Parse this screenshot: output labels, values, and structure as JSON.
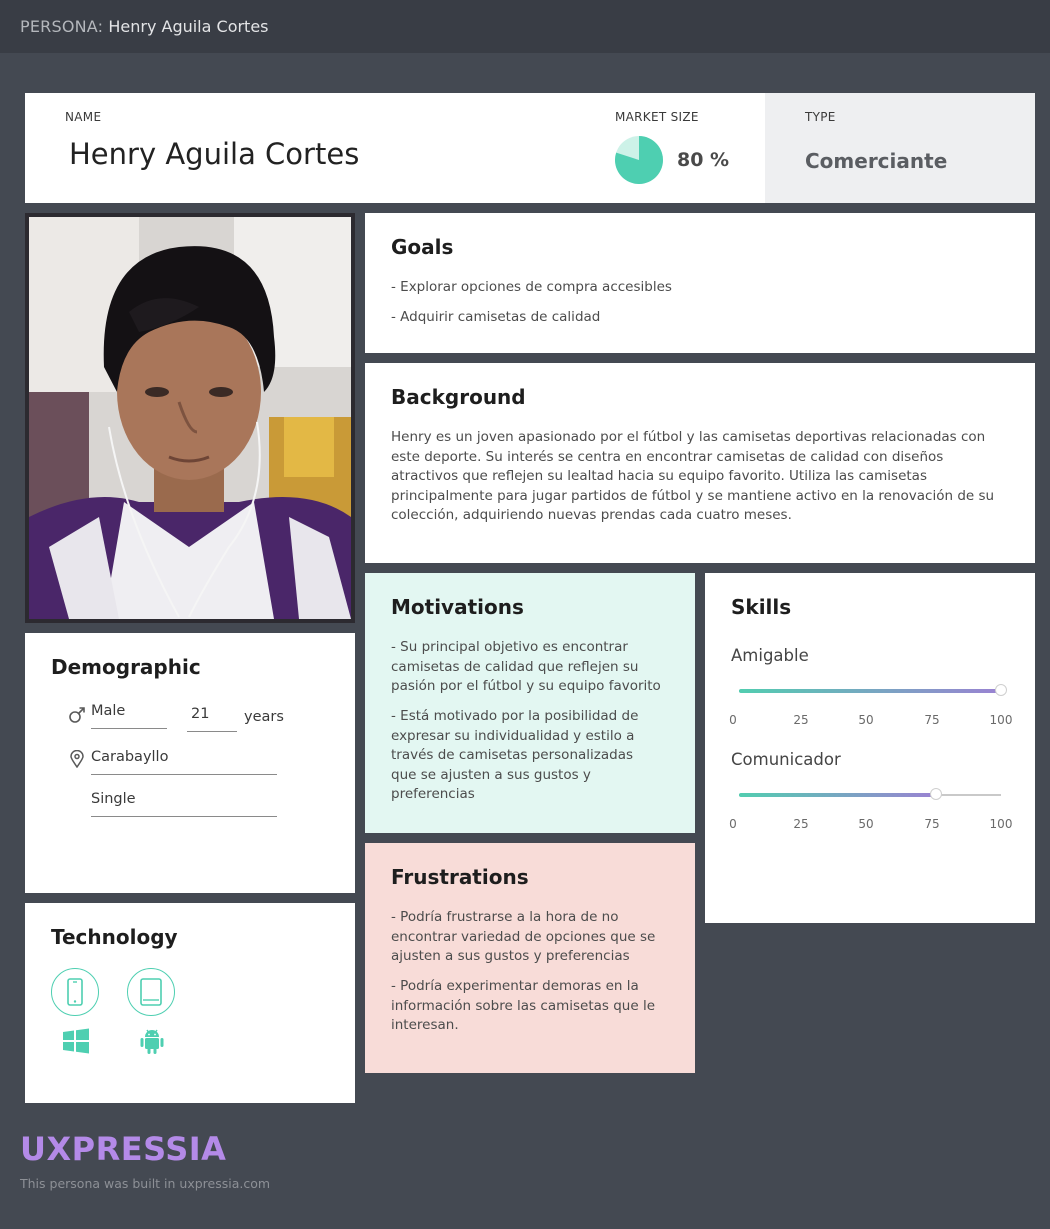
{
  "topbar": {
    "label": "PERSONA:",
    "name": "Henry Aguila Cortes"
  },
  "header": {
    "name_label": "NAME",
    "name": "Henry Aguila Cortes",
    "market_label": "MARKET SIZE",
    "market_value": "80 %",
    "market_fraction": 0.8,
    "type_label": "TYPE",
    "type_value": "Comerciante"
  },
  "colors": {
    "accent": "#4ecfb1",
    "accent_light": "#cdf2e8",
    "brand": "#b48ae8"
  },
  "goals": {
    "title": "Goals",
    "items": [
      "- Explorar opciones de compra accesibles",
      "- Adquirir camisetas de calidad"
    ]
  },
  "background": {
    "title": "Background",
    "text": "Henry es un joven apasionado por el fútbol y las camisetas deportivas relacionadas con este deporte. Su interés se centra en encontrar camisetas de calidad con diseños atractivos que reflejen su lealtad hacia su equipo favorito. Utiliza las camisetas principalmente para jugar partidos de fútbol y se mantiene activo en la renovación de su colección, adquiriendo nuevas prendas cada cuatro meses."
  },
  "motivations": {
    "title": "Motivations",
    "items": [
      "- Su principal objetivo es encontrar camisetas de calidad que reflejen su pasión por el fútbol y su equipo favorito",
      "- Está motivado por la posibilidad de expresar su individualidad y estilo a través de camisetas personalizadas que se ajusten a sus gustos y preferencias"
    ]
  },
  "frustrations": {
    "title": "Frustrations",
    "items": [
      "- Podría frustrarse a la hora de no encontrar variedad de opciones que se ajusten a sus gustos y preferencias",
      "- Podría experimentar demoras en la información sobre las camisetas que le interesan."
    ]
  },
  "skills": {
    "title": "Skills",
    "ticks": [
      "0",
      "25",
      "50",
      "75",
      "100"
    ],
    "items": [
      {
        "name": "Amigable",
        "value": 100
      },
      {
        "name": "Comunicador",
        "value": 75
      }
    ]
  },
  "demographic": {
    "title": "Demographic",
    "gender": "Male",
    "age": "21",
    "age_unit": "years",
    "location": "Carabayllo",
    "status": "Single"
  },
  "technology": {
    "title": "Technology",
    "devices": [
      "mobile-phone-icon",
      "tablet-icon"
    ],
    "platforms": [
      "windows-icon",
      "android-icon"
    ]
  },
  "footer": {
    "brand": "UXPRESSIA",
    "built": "This persona was built in uxpressia.com"
  }
}
